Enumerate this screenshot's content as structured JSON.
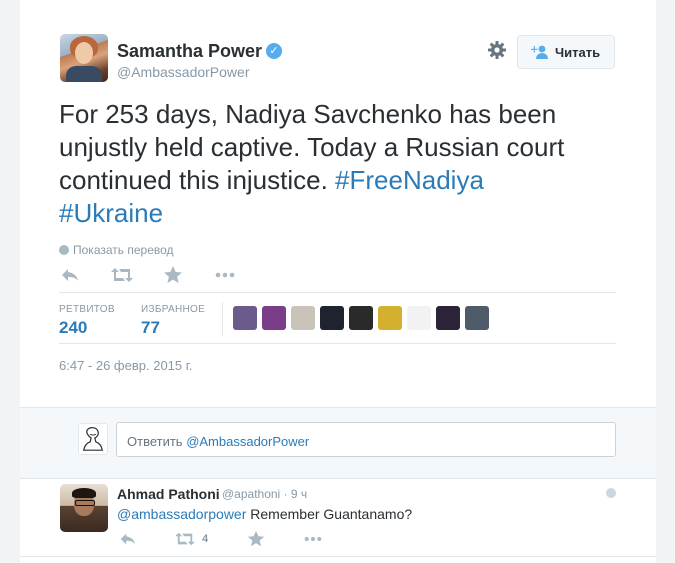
{
  "tweet": {
    "author_name": "Samantha Power",
    "author_handle": "@AmbassadorPower",
    "verified_mark": "✓",
    "follow_label": "Читать",
    "text_plain": "For 253 days, Nadiya Savchenko has been unjustly held captive. Today a Russian court continued this injustice. ",
    "hashtag_1": "#FreeNadiya",
    "hashtag_2": "#Ukraine",
    "translate_label": "Показать перевод",
    "stats": {
      "retweets_label": "РЕТВИТОВ",
      "retweets_value": "240",
      "favorites_label": "ИЗБРАННОЕ",
      "favorites_value": "77"
    },
    "timestamp": "6:47 - 26 февр. 2015 г.",
    "mini_avatar_colors": [
      "#6b5a8c",
      "#7a3d88",
      "#c9c3b8",
      "#1f2330",
      "#2a2a2a",
      "#d4b030",
      "#f2f2f2",
      "#2c2436",
      "#4e5b68"
    ]
  },
  "composer": {
    "placeholder_prefix": "Ответить ",
    "placeholder_mention": "@AmbassadorPower"
  },
  "reply": {
    "author_name": "Ahmad Pathoni",
    "author_handle": "@apathoni",
    "time": "9 ч",
    "mention": "@ambassadorpower",
    "text": " Remember Guantanamo?",
    "retweet_count": "4"
  },
  "colors": {
    "link": "#2b7bb9",
    "muted": "#8899a6",
    "text": "#292f33",
    "verified": "#55acee"
  }
}
